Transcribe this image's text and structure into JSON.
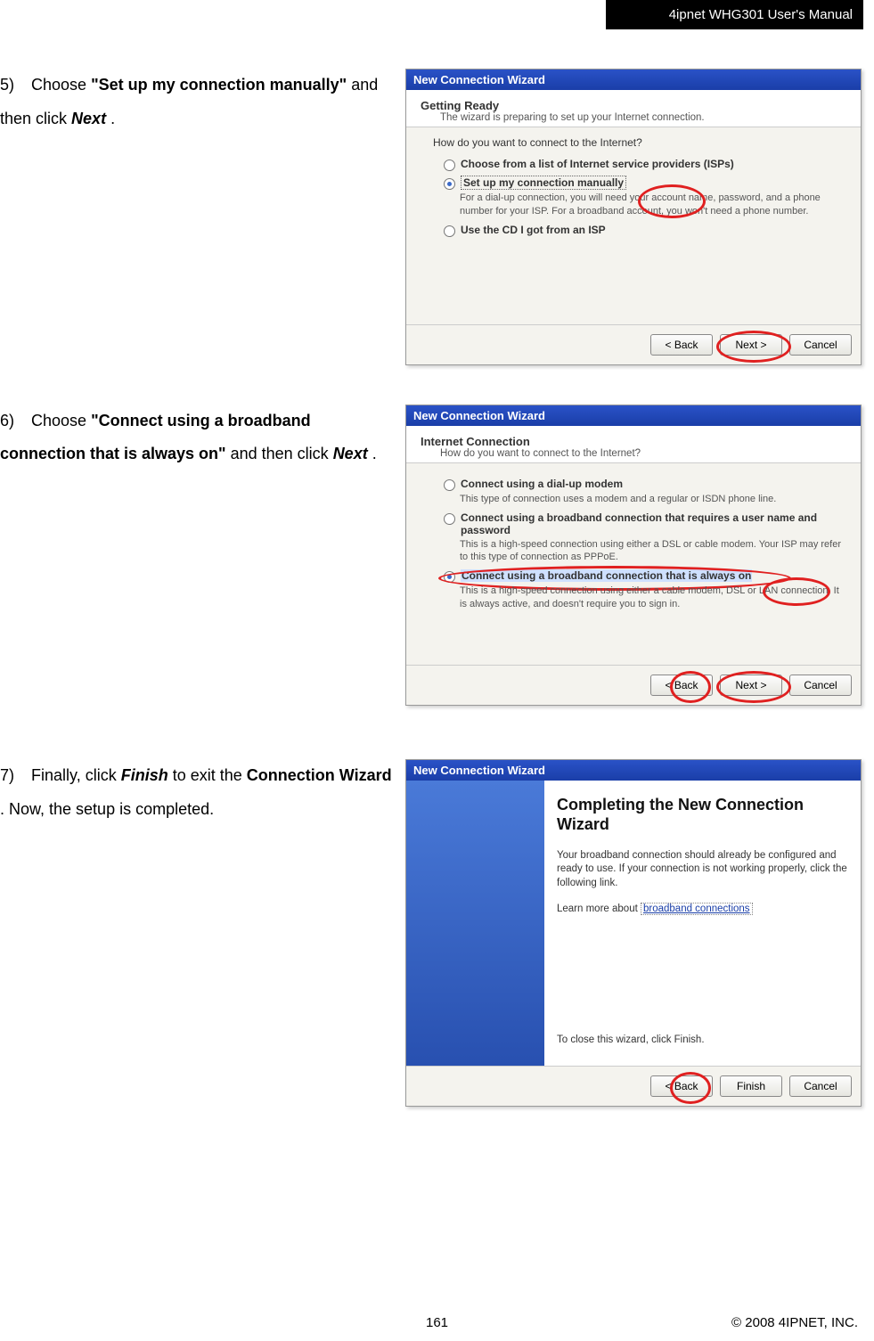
{
  "header": "4ipnet WHG301 User's Manual",
  "steps": [
    {
      "num": "5)",
      "parts": [
        "Choose ",
        "\"Set up my connection manually\"",
        " and then click ",
        "Next",
        "."
      ]
    },
    {
      "num": "6)",
      "parts": [
        "Choose ",
        "\"Connect using a broadband connection that is always on\"",
        " and then click ",
        "Next",
        "."
      ]
    },
    {
      "num": "7)",
      "parts": [
        "Finally, click ",
        "Finish",
        " to exit the ",
        "Connection Wizard",
        ". Now, the setup is completed."
      ]
    }
  ],
  "wizard1": {
    "title": "New Connection Wizard",
    "subtitle": "Getting Ready",
    "subdesc": "The wizard is preparing to set up your Internet connection.",
    "question": "How do you want to connect to the Internet?",
    "opt1": "Choose from a list of Internet service providers (ISPs)",
    "opt2": "Set up my connection manually",
    "opt2desc": "For a dial-up connection, you will need your account name, password, and a phone number for your ISP. For a broadband account, you won't need a phone number.",
    "opt3": "Use the CD I got from an ISP",
    "btnBack": "< Back",
    "btnNext": "Next >",
    "btnCancel": "Cancel"
  },
  "wizard2": {
    "title": "New Connection Wizard",
    "subtitle": "Internet Connection",
    "subdesc": "How do you want to connect to the Internet?",
    "opt1": "Connect using a dial-up modem",
    "opt1desc": "This type of connection uses a modem and a regular or ISDN phone line.",
    "opt2": "Connect using a broadband connection that requires a user name and password",
    "opt2desc": "This is a high-speed connection using either a DSL or cable modem. Your ISP may refer to this type of connection as PPPoE.",
    "opt3": "Connect using a broadband connection that is always on",
    "opt3desc": "This is a high-speed connection using either a cable modem, DSL or LAN connection. It is always active, and doesn't require you to sign in.",
    "btnBack": "< Back",
    "btnNext": "Next >",
    "btnCancel": "Cancel"
  },
  "wizard3": {
    "title": "New Connection Wizard",
    "heading": "Completing the New Connection Wizard",
    "p1": "Your broadband connection should already be configured and ready to use. If your connection is not working properly, click the following link.",
    "linkLabel": "Learn more about ",
    "linkText": "broadband connections",
    "closeText": "To close this wizard, click Finish.",
    "btnBack": "< Back",
    "btnFinish": "Finish",
    "btnCancel": "Cancel"
  },
  "footer": {
    "page": "161",
    "copyright": "© 2008 4IPNET, INC."
  }
}
